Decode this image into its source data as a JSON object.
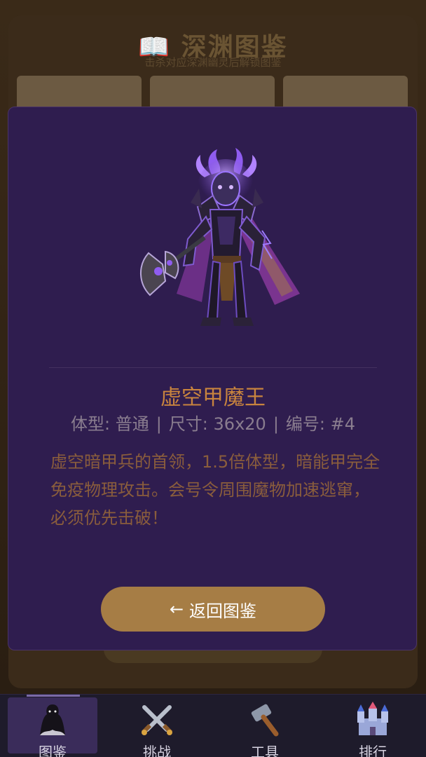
{
  "background": {
    "title": "📖 深渊图鉴",
    "subtitle": "击杀对应深渊幽灵后解锁图鉴"
  },
  "modal": {
    "monster_name": "虚空甲魔王",
    "meta": {
      "size_type": "体型: 普通",
      "dimensions": "尺寸: 36x20",
      "number": "编号: #4",
      "separator": "|"
    },
    "description": "虚空暗甲兵的首领，1.5倍体型，暗能甲完全免疫物理攻击。会号令周围魔物加速逃窜，必须优先击破！",
    "back_button": {
      "arrow": "←",
      "label": "返回图鉴"
    },
    "monster_icon": "void-armor-demon-king-sprite"
  },
  "nav": {
    "items": [
      {
        "label": "图鉴",
        "icon": "ghost-figure-icon",
        "active": true
      },
      {
        "label": "挑战",
        "icon": "crossed-swords-icon",
        "active": false
      },
      {
        "label": "工具",
        "icon": "hammer-icon",
        "active": false
      },
      {
        "label": "排行",
        "icon": "castle-icon",
        "active": false
      }
    ]
  },
  "colors": {
    "modal_bg": "#2f1d4f",
    "accent_orange": "#c8843e",
    "button_gold": "#a67d45",
    "nav_bg": "#1e1b2b"
  }
}
